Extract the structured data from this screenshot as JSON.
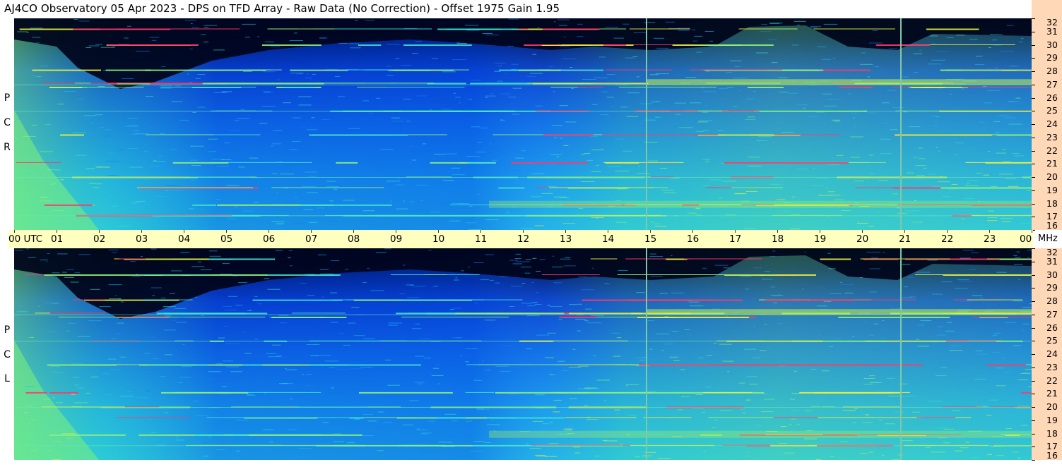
{
  "title": "AJ4CO Observatory  05 Apr 2023  -  DPS on TFD Array  -  Raw Data (No Correction)  -  Offset 1975  Gain 1.95",
  "panels": [
    {
      "id": "rcp",
      "side_label": [
        "R",
        "C",
        "P"
      ]
    },
    {
      "id": "lcp",
      "side_label": [
        "L",
        "C",
        "P"
      ]
    }
  ],
  "time_axis": {
    "labels": [
      "00  UTC",
      "01",
      "02",
      "03",
      "04",
      "05",
      "06",
      "07",
      "08",
      "09",
      "10",
      "11",
      "12",
      "13",
      "14",
      "15",
      "16",
      "17",
      "18",
      "19",
      "20",
      "21",
      "22",
      "23",
      "00"
    ],
    "unit_label": "MHz"
  },
  "freq_axis": {
    "labels": [
      "32",
      "31",
      "30",
      "29",
      "28",
      "27",
      "26",
      "25",
      "24",
      "23",
      "22",
      "21",
      "20",
      "19",
      "18",
      "17",
      "16"
    ]
  },
  "chart_data": {
    "type": "heatmap",
    "title": "AJ4CO Observatory  05 Apr 2023  -  DPS on TFD Array  -  Raw Data (No Correction)  -  Offset 1975  Gain 1.95",
    "xlabel": "UTC",
    "ylabel": "MHz",
    "x_range_hours": [
      0,
      24
    ],
    "y_range_mhz": [
      16,
      32
    ],
    "panels": [
      "RCP",
      "LCP"
    ],
    "colormap": [
      "#000022",
      "#001a8c",
      "#0a4bd8",
      "#1a7bf0",
      "#22b8ee",
      "#3ee0d2",
      "#8ef07a",
      "#e8f040",
      "#ff6040",
      "#ff2aa0",
      "#ffffff"
    ],
    "interference_lines_mhz": [
      31.2,
      30.0,
      28.1,
      27.1,
      26.8,
      25.0,
      23.2,
      21.1,
      20.0,
      19.2,
      17.9,
      17.1
    ],
    "vertical_events_utc": [
      14.9,
      20.9
    ]
  }
}
